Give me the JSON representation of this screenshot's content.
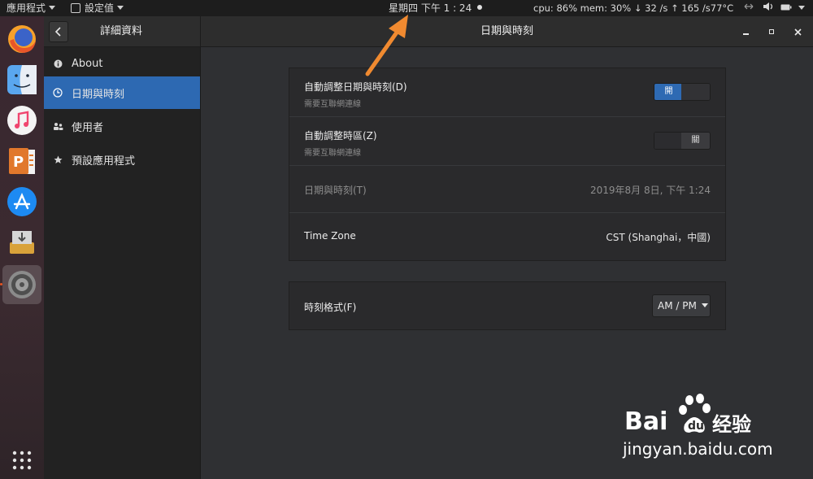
{
  "topbar": {
    "apps_menu": "應用程式",
    "settings_menu": "設定值",
    "clock": "星期四 下午 1 : 24",
    "sysmon": "cpu: 86% mem: 30% ↓  32  /s ↑ 165  /s77°C",
    "icons": [
      "network-icon",
      "volume-icon",
      "battery-icon",
      "power-menu-icon"
    ]
  },
  "dock": {
    "items": [
      "firefox-icon",
      "finder-icon",
      "music-icon",
      "presentation-icon",
      "app-store-icon",
      "installer-icon",
      "system-settings-icon"
    ],
    "show_apps": "apps-grid-icon"
  },
  "window": {
    "sidebar_title": "詳細資料",
    "main_title": "日期與時刻",
    "controls": [
      "minimize",
      "maximize",
      "close"
    ]
  },
  "sidebar": {
    "items": [
      {
        "label": "About",
        "icon": "info-icon"
      },
      {
        "label": "日期與時刻",
        "icon": "clock-icon",
        "selected": true
      },
      {
        "label": "使用者",
        "icon": "users-icon"
      },
      {
        "label": "預設應用程式",
        "icon": "star-icon"
      }
    ]
  },
  "datetime": {
    "auto_datetime": {
      "title": "自動調整日期與時刻(D)",
      "subtitle": "需要互聯網連線",
      "switch_label": "開",
      "on": true
    },
    "auto_timezone": {
      "title": "自動調整時區(Z)",
      "subtitle": "需要互聯網連線",
      "switch_label": "關",
      "on": false
    },
    "datetime_row": {
      "title": "日期與時刻(T)",
      "value": "2019年8月 8日, 下午  1:24"
    },
    "timezone_row": {
      "title": "Time Zone",
      "value": "CST (Shanghai，中國)"
    },
    "time_format": {
      "title": "時刻格式(F)",
      "value": "AM / PM"
    }
  },
  "colors": {
    "accent": "#2d69b2",
    "annotation_arrow": "#f08a30"
  },
  "watermark": {
    "brand_left": "Bai",
    "brand_right": "du",
    "name": "经验",
    "site": "jingyan.baidu.com"
  }
}
